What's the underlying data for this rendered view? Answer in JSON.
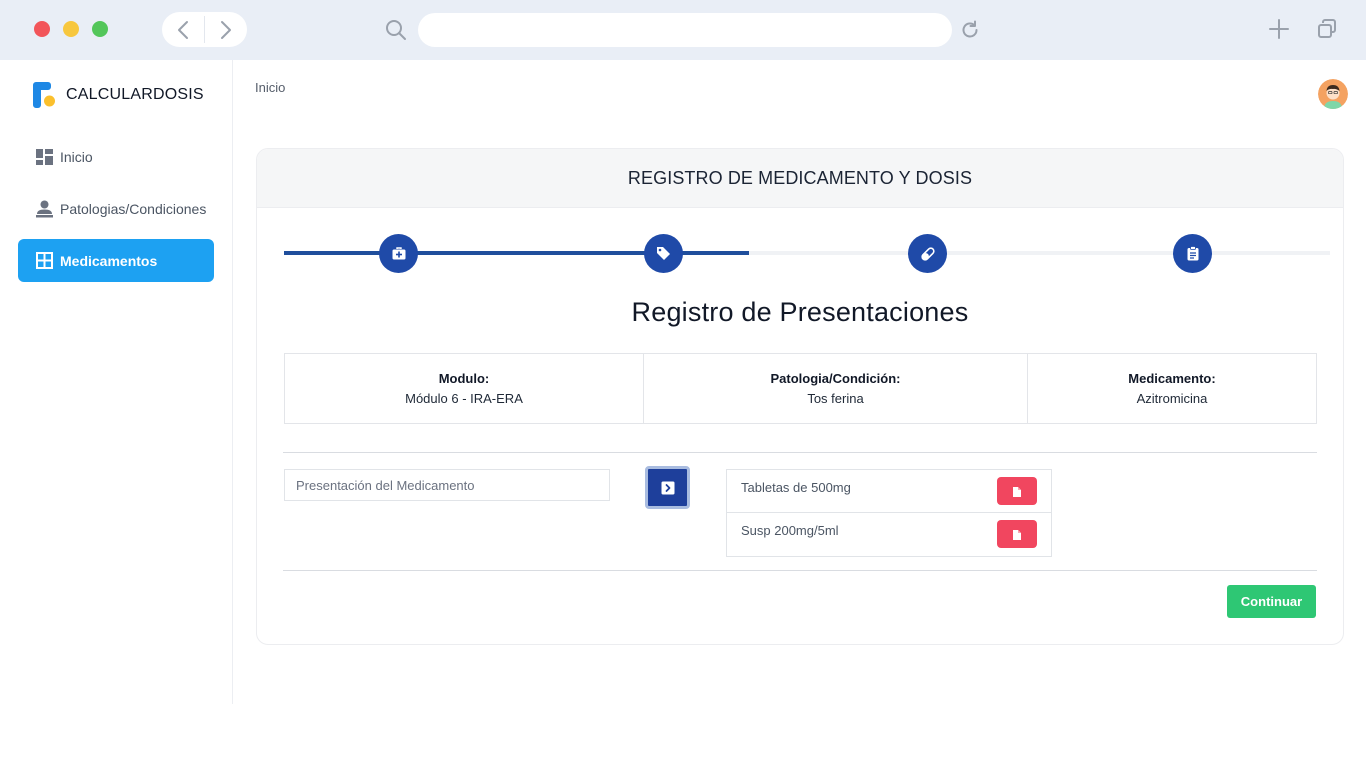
{
  "browser": {
    "url": "",
    "icons": {
      "back": "chevron-left-icon",
      "forward": "chevron-right-icon",
      "search": "search-icon",
      "reload": "reload-icon",
      "new_tab": "plus-icon",
      "tabs": "copy-icon"
    }
  },
  "sidebar": {
    "brand": "CALCULARDOSIS",
    "items": [
      {
        "label": "Inicio",
        "icon": "dashboard-icon",
        "active": false
      },
      {
        "label": "Patologias/Condiciones",
        "icon": "user-tie-icon",
        "active": false
      },
      {
        "label": "Medicamentos",
        "icon": "grid-icon",
        "active": true
      }
    ]
  },
  "breadcrumb": "Inicio",
  "card": {
    "header": "REGISTRO DE MEDICAMENTO Y DOSIS",
    "steps": [
      {
        "icon": "medkit-icon"
      },
      {
        "icon": "tag-icon"
      },
      {
        "icon": "pill-icon"
      },
      {
        "icon": "clipboard-icon"
      }
    ],
    "progress_steps_completed": 2,
    "section_title": "Registro de Presentaciones",
    "info": [
      {
        "label": "Modulo:",
        "value": "Módulo 6 - IRA-ERA"
      },
      {
        "label": "Patologia/Condición:",
        "value": "Tos ferina"
      },
      {
        "label": "Medicamento:",
        "value": "Azitromicina"
      }
    ],
    "input": {
      "placeholder": "Presentación del Medicamento",
      "value": ""
    },
    "presentations": [
      {
        "name": "Tabletas de 500mg"
      },
      {
        "name": "Susp 200mg/5ml"
      }
    ],
    "continue_label": "Continuar"
  },
  "colors": {
    "primary": "#1f4aa8",
    "sidebar_active": "#1da1f2",
    "danger": "#f1465f",
    "success": "#2ec774"
  }
}
